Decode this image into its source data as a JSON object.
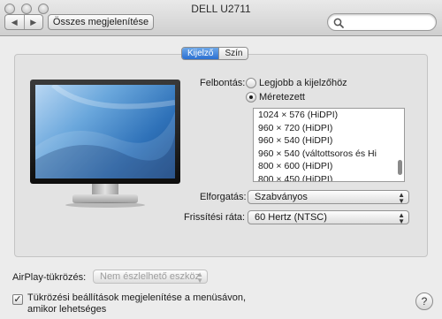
{
  "window": {
    "title": "DELL U2711"
  },
  "toolbar": {
    "back_glyph": "◀",
    "forward_glyph": "▶",
    "show_all_label": "Összes megjelenítése",
    "search_placeholder": ""
  },
  "tabs": [
    {
      "label": "Kijelző",
      "active": true
    },
    {
      "label": "Szín",
      "active": false
    }
  ],
  "resolution": {
    "label": "Felbontás:",
    "options": [
      {
        "label": "Legjobb a kijelzőhöz",
        "checked": false
      },
      {
        "label": "Méretezett",
        "checked": true
      }
    ],
    "list": [
      "1024 × 576 (HiDPI)",
      "960 × 720 (HiDPI)",
      "960 × 540 (HiDPI)",
      "960 × 540 (váltottsoros és Hi",
      "800 × 600 (HiDPI)",
      "800 × 450 (HiDPI)"
    ]
  },
  "rotation": {
    "label": "Elforgatás:",
    "value": "Szabványos"
  },
  "refresh": {
    "label": "Frissítési ráta:",
    "value": "60 Hertz (NTSC)"
  },
  "airplay": {
    "label": "AirPlay-tükrözés:",
    "value": "Nem észlelhető eszköz"
  },
  "mirroring_option": {
    "line1": "Tükrözési beállítások megjelenítése a menüsávon,",
    "line2": "amikor lehetséges",
    "checked": true,
    "check_glyph": "✓"
  },
  "help": {
    "glyph": "?"
  },
  "colors": {
    "accent": "#2b70d2",
    "panel": "#e3e3e3",
    "window": "#ececec"
  }
}
